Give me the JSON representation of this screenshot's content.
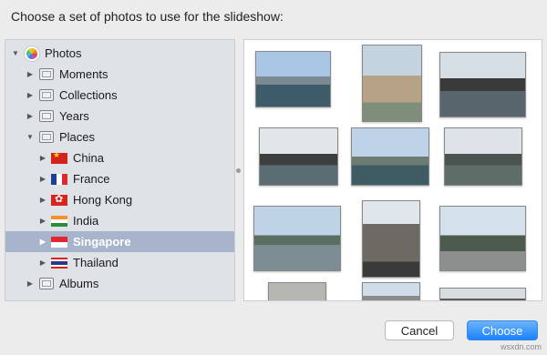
{
  "dialog": {
    "title": "Choose a set of photos to use for the slideshow:"
  },
  "sidebar": {
    "items": [
      {
        "label": "Photos",
        "icon": "photos-app-icon",
        "disclosure": "expanded"
      },
      {
        "label": "Moments",
        "icon": "folder-icon",
        "disclosure": "collapsed"
      },
      {
        "label": "Collections",
        "icon": "folder-icon",
        "disclosure": "collapsed"
      },
      {
        "label": "Years",
        "icon": "folder-icon",
        "disclosure": "collapsed"
      },
      {
        "label": "Places",
        "icon": "folder-icon",
        "disclosure": "expanded"
      },
      {
        "label": "China",
        "icon": "china-flag-icon",
        "disclosure": "collapsed"
      },
      {
        "label": "France",
        "icon": "france-flag-icon",
        "disclosure": "collapsed"
      },
      {
        "label": "Hong Kong",
        "icon": "hong-kong-flag-icon",
        "disclosure": "collapsed"
      },
      {
        "label": "India",
        "icon": "india-flag-icon",
        "disclosure": "collapsed"
      },
      {
        "label": "Singapore",
        "icon": "singapore-flag-icon",
        "disclosure": "collapsed",
        "selected": true
      },
      {
        "label": "Thailand",
        "icon": "thailand-flag-icon",
        "disclosure": "collapsed"
      },
      {
        "label": "Albums",
        "icon": "folder-icon",
        "disclosure": "collapsed"
      }
    ],
    "selection_color": "#a7b4cc"
  },
  "photo_grid": {
    "visible_thumbnails": 12
  },
  "buttons": {
    "cancel_label": "Cancel",
    "choose_label": "Choose"
  },
  "watermark": "wsxdn.com",
  "colors": {
    "accent": "#1a82fb",
    "background": "#ececec"
  }
}
